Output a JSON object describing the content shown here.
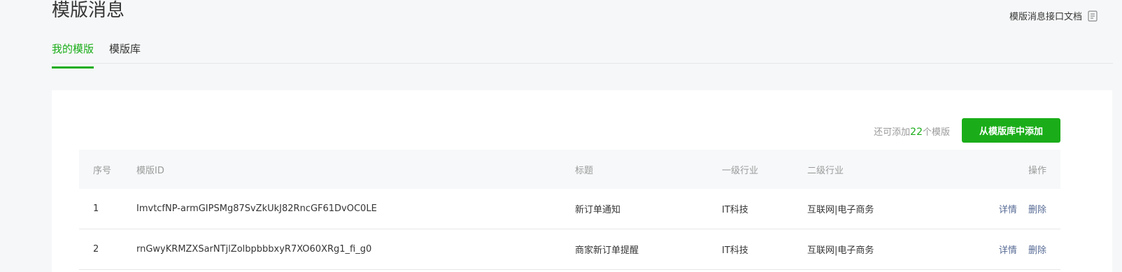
{
  "page": {
    "title": "模版消息",
    "doc_link": "模版消息接口文档"
  },
  "tabs": [
    {
      "label": "我的模版",
      "active": true
    },
    {
      "label": "模版库",
      "active": false
    }
  ],
  "panel": {
    "quota_prefix": "还可添加",
    "quota_count": "22",
    "quota_suffix": "个模版",
    "add_button": "从模版库中添加"
  },
  "table": {
    "headers": {
      "seq": "序号",
      "id": "模版ID",
      "title": "标题",
      "industry1": "一级行业",
      "industry2": "二级行业",
      "ops": "操作"
    },
    "rows": [
      {
        "seq": "1",
        "id": "ImvtcfNP-armGIPSMg87SvZkUkJ82RncGF61DvOC0LE",
        "title": "新订单通知",
        "industry1": "IT科技",
        "industry2": "互联网|电子商务",
        "detail": "详情",
        "delete": "删除"
      },
      {
        "seq": "2",
        "id": "rnGwyKRMZXSarNTjlZolbpbbbxyR7XO60XRg1_fi_g0",
        "title": "商家新订单提醒",
        "industry1": "IT科技",
        "industry2": "互联网|电子商务",
        "detail": "详情",
        "delete": "删除"
      }
    ]
  },
  "colors": {
    "accent": "#1aad19",
    "link": "#576b95",
    "muted": "#9a9a9a"
  },
  "icons": {
    "doc": "document-icon"
  }
}
